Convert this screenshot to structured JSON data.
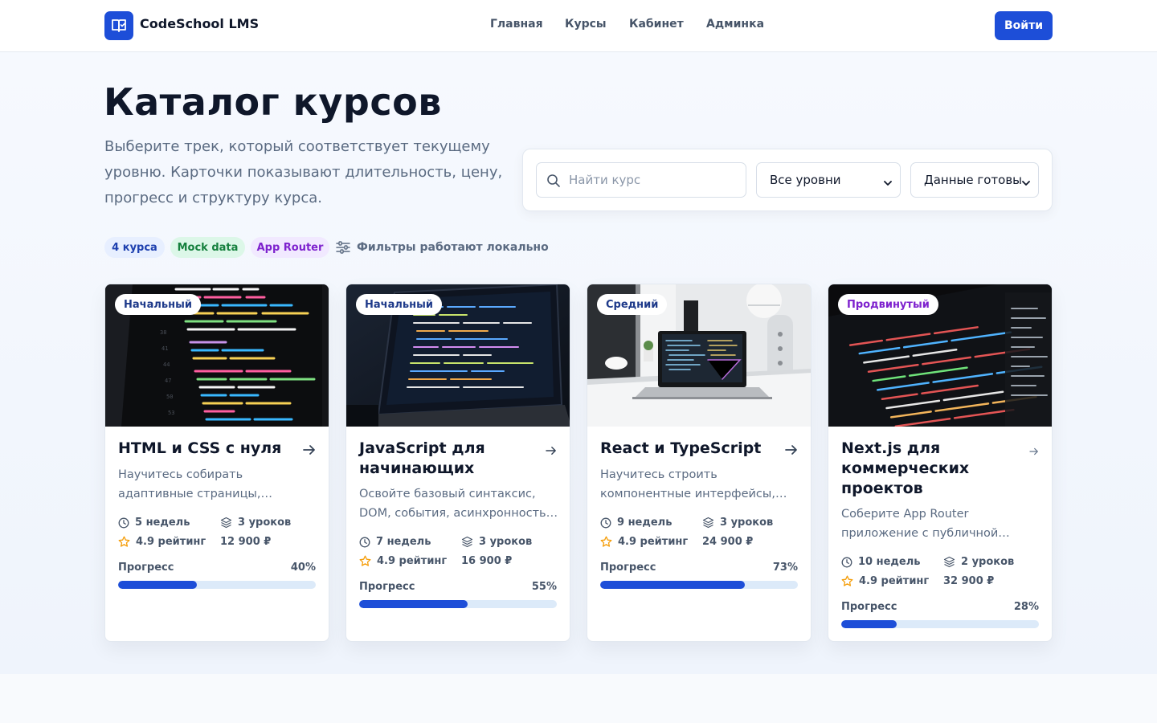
{
  "app": {
    "name": "CodeSchool LMS"
  },
  "nav": {
    "items": [
      "Главная",
      "Курсы",
      "Кабинет",
      "Админка"
    ]
  },
  "header": {
    "login_label": "Войти"
  },
  "hero": {
    "title": "Каталог курсов",
    "subtitle": "Выберите трек, который соответствует текущему уровню. Карточки показывают длительность, цену, прогресс и структуру курса."
  },
  "filters": {
    "search_placeholder": "Найти курс",
    "level_value": "Все уровни",
    "status_value": "Данные готовы"
  },
  "chips": [
    "4 курса",
    "Mock data",
    "App Router"
  ],
  "local_note": "Фильтры работают локально",
  "colors": {
    "accent": "#1d4ed8",
    "star": "#f59e0b"
  },
  "courses": [
    {
      "level": "Начальный",
      "title": "HTML и CSS с нуля",
      "description": "Научитесь собирать адаптивные страницы, работать с сетками, компонентами и стилями.",
      "duration": "5 недель",
      "lessons": "3 уроков",
      "rating": "4.9 рейтинг",
      "price": "12 900 ₽",
      "progress_label": "Прогресс",
      "progress_text": "40%",
      "progress": 0.4
    },
    {
      "level": "Начальный",
      "title": "JavaScript для начинающих",
      "description": "Освойте базовый синтаксис, DOM, события, асинхронность и работу с API.",
      "duration": "7 недель",
      "lessons": "3 уроков",
      "rating": "4.9 рейтинг",
      "price": "16 900 ₽",
      "progress_label": "Прогресс",
      "progress_text": "55%",
      "progress": 0.55
    },
    {
      "level": "Средний",
      "title": "React и TypeScript",
      "description": "Научитесь строить компонентные интерфейсы, типизировать данные и состояние.",
      "duration": "9 недель",
      "lessons": "3 уроков",
      "rating": "4.9 рейтинг",
      "price": "24 900 ₽",
      "progress_label": "Прогресс",
      "progress_text": "73%",
      "progress": 0.73
    },
    {
      "level": "Продвинутый",
      "title": "Next.js для коммерческих проектов",
      "description": "Соберите App Router приложение с публичной частью и личным кабинетом.",
      "duration": "10 недель",
      "lessons": "2 уроков",
      "rating": "4.9 рейтинг",
      "price": "32 900 ₽",
      "progress_label": "Прогресс",
      "progress_text": "28%",
      "progress": 0.28
    }
  ]
}
